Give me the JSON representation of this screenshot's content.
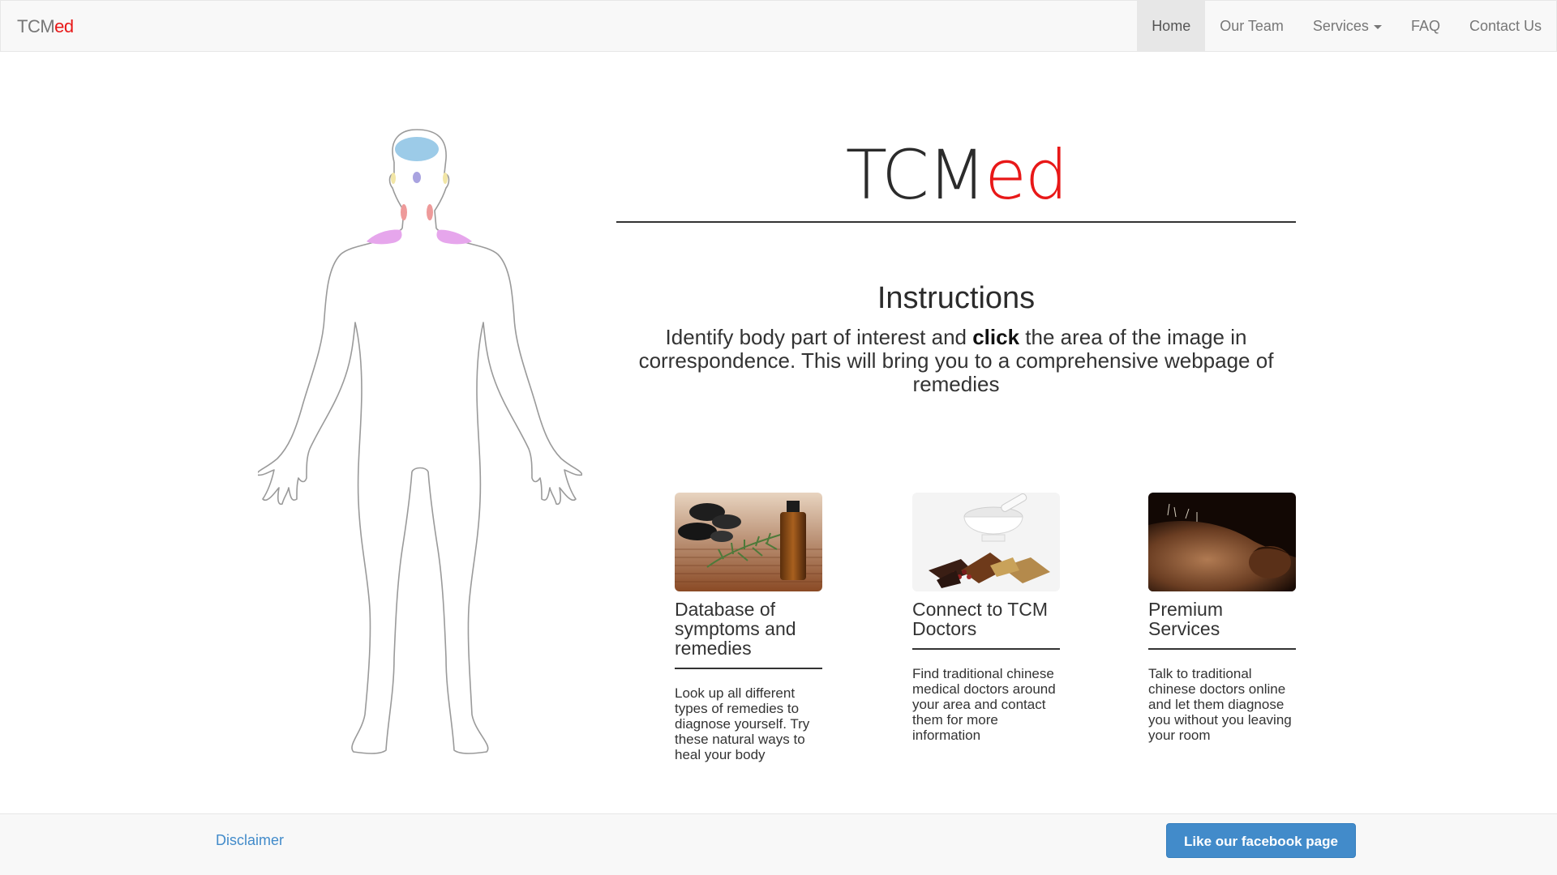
{
  "navbar": {
    "brand_prefix": "TCM",
    "brand_accent": "ed",
    "items": [
      {
        "label": "Home",
        "active": true
      },
      {
        "label": "Our Team"
      },
      {
        "label": "Services",
        "dropdown": true
      },
      {
        "label": "FAQ"
      },
      {
        "label": "Contact Us"
      }
    ]
  },
  "hero": {
    "title_prefix": "TCM",
    "title_accent": "ed"
  },
  "instructions": {
    "heading": "Instructions",
    "text_before": "Identify body part of interest and ",
    "text_bold": "click",
    "text_after": " the area of the image in correspondence. This will bring you to a comprehensive webpage of remedies"
  },
  "cards": [
    {
      "title": "Database of symptoms and remedies",
      "text": "Look up all different types of remedies to diagnose yourself. Try these natural ways to heal your body"
    },
    {
      "title": "Connect to TCM Doctors",
      "text": "Find traditional chinese medical doctors around your area and contact them for more information"
    },
    {
      "title": "Premium Services",
      "text": "Talk to traditional chinese doctors online and let them diagnose you without you leaving your room"
    }
  ],
  "footer": {
    "disclaimer": "Disclaimer",
    "facebook_button": "Like our facebook page"
  },
  "colors": {
    "accent": "#e81818",
    "link": "#428bca",
    "navbar_bg": "#f8f8f8"
  }
}
